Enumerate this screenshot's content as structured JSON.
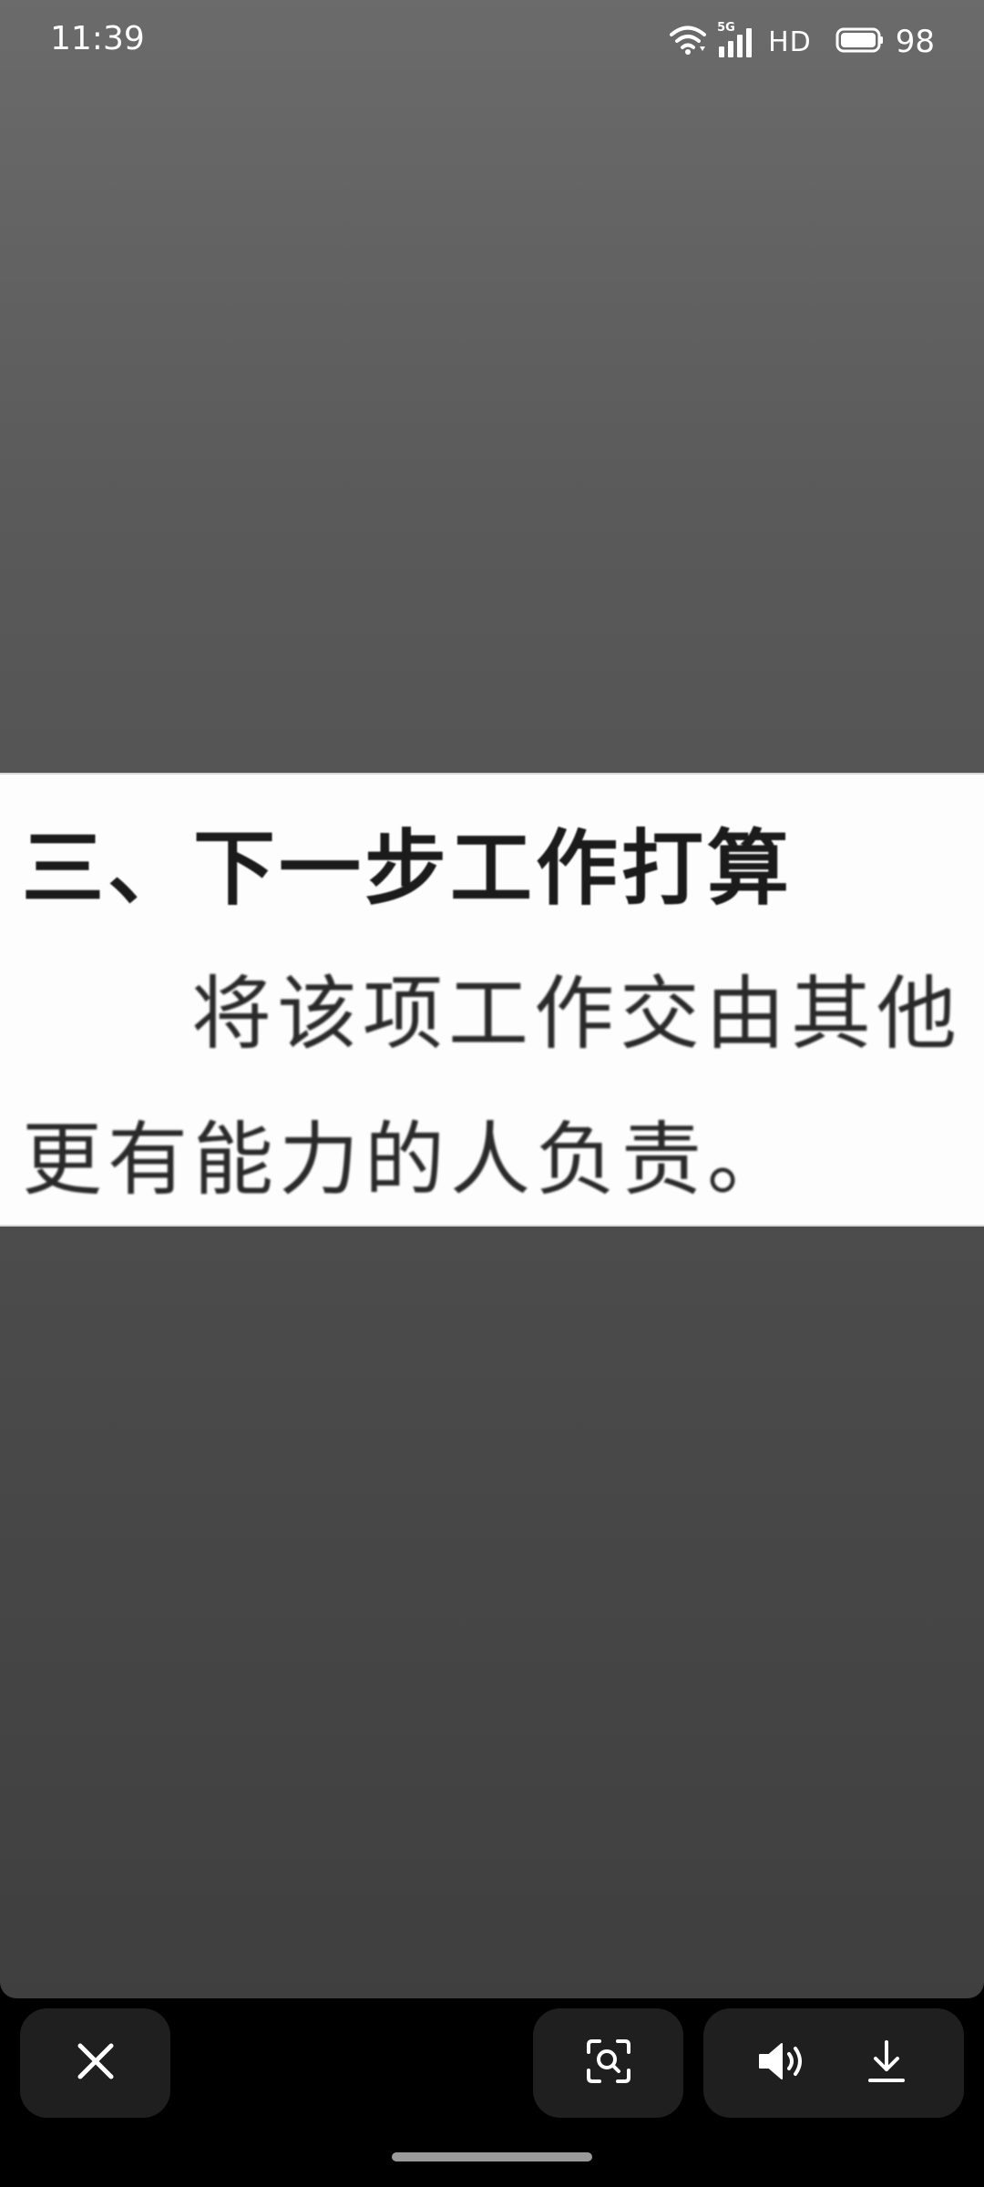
{
  "status_bar": {
    "time": "11:39",
    "network_label": "5G",
    "hd_label": "HD",
    "battery_level": "98",
    "icons": [
      "wifi-icon",
      "signal-icon",
      "battery-icon"
    ]
  },
  "document": {
    "heading": "三、下一步工作打算",
    "line1": "将该项工作交由其他",
    "line2": "更有能力的人负责。"
  },
  "toolbar": {
    "icons": [
      "close-icon",
      "scan-search-icon",
      "speaker-icon",
      "download-icon"
    ]
  },
  "colors": {
    "viewer_top": "#6b6b6b",
    "viewer_bottom": "#3f3f3f",
    "button_bg": "#1f1f1f",
    "document_bg": "#fdfdfd"
  }
}
